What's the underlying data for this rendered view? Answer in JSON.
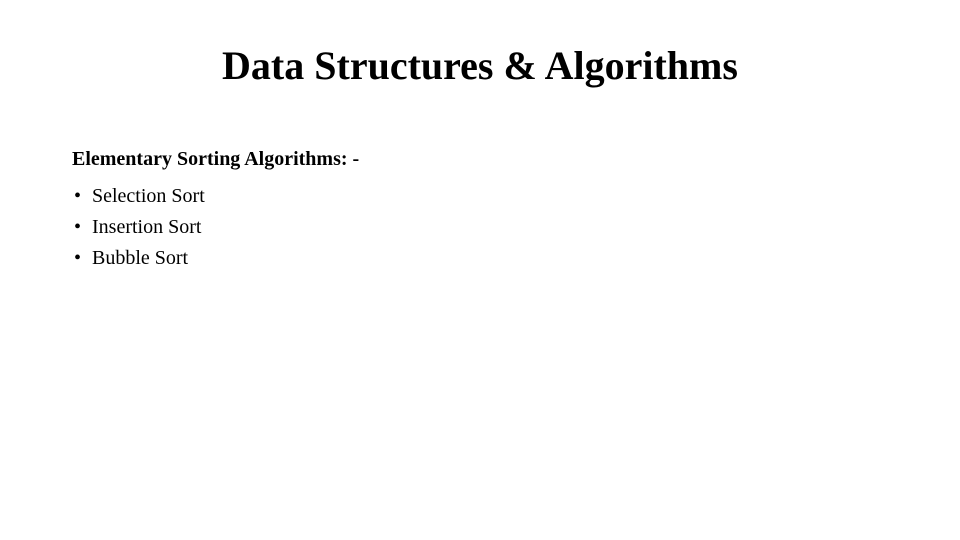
{
  "title": "Data Structures & Algorithms",
  "subtitle": "Elementary Sorting Algorithms: -",
  "items": [
    "Selection Sort",
    "Insertion Sort",
    "Bubble Sort"
  ]
}
